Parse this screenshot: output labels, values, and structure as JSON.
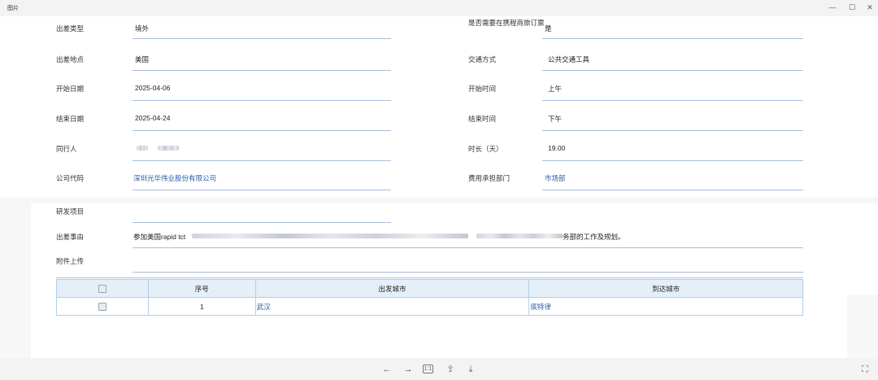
{
  "window": {
    "title": "图片",
    "minimize_glyph": "—",
    "maximize_glyph": "☐",
    "close_glyph": "✕"
  },
  "form": {
    "trip_type_label": "出差类型",
    "trip_type_value": "境外",
    "need_ctrip_label": "是否需要在携程商旅订票",
    "need_ctrip_value": "是",
    "destination_label": "出差地点",
    "destination_value": "美国",
    "transport_label": "交通方式",
    "transport_value": "公共交通工具",
    "start_date_label": "开始日期",
    "start_date_value": "2025-04-06",
    "start_time_label": "开始时间",
    "start_time_value": "上午",
    "end_date_label": "结束日期",
    "end_date_value": "2025-04-24",
    "end_time_label": "结束时间",
    "end_time_value": "下午",
    "companion_label": "同行人",
    "duration_label": "时长（天）",
    "duration_value": "19.00",
    "company_label": "公司代码",
    "company_value": "深圳光华伟业股份有限公司",
    "cost_dept_label": "费用承担部门",
    "cost_dept_value": "市场部",
    "project_label": "研发项目",
    "reason_label": "出差事由",
    "reason_prefix": "参加美国rapid tct",
    "reason_suffix": "务部的工作及规划。",
    "attachment_label": "附件上传"
  },
  "table": {
    "headers": [
      "",
      "序号",
      "出发城市",
      "到达城市"
    ],
    "rows": [
      {
        "index": "1",
        "from": "武汉",
        "to": "底特律"
      }
    ]
  },
  "toolbar": {
    "prev_icon": "←",
    "next_icon": "→",
    "actual_size_icon": "1:1",
    "share_icon": "⇪",
    "download_icon": "⤓",
    "fullscreen_icon": "⛶"
  },
  "colors": {
    "underline": "#a9bfdb",
    "link": "#2f5fa7",
    "table_header_bg": "#e4eff9",
    "table_border": "#b5cde8"
  }
}
